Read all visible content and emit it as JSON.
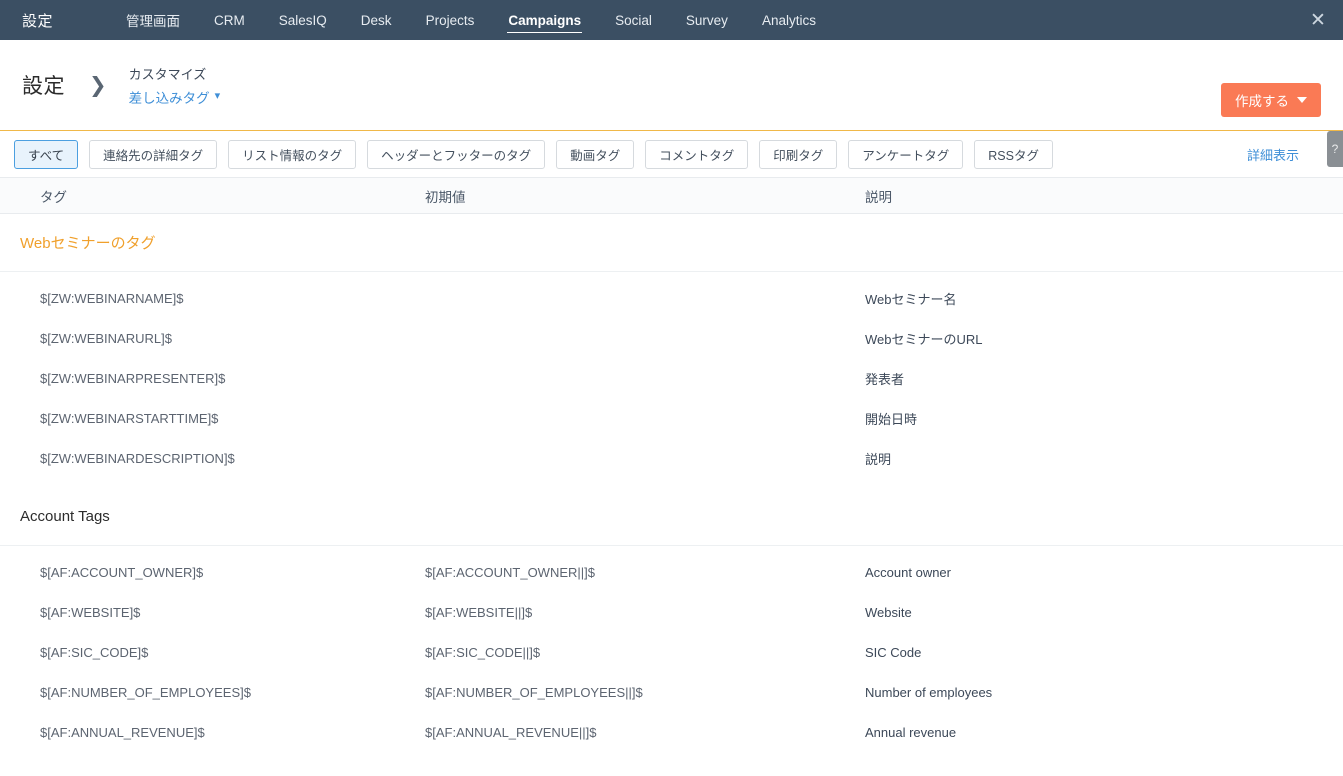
{
  "topnav": {
    "brand": "設定",
    "items": [
      {
        "label": "管理画面",
        "active": false
      },
      {
        "label": "CRM",
        "active": false
      },
      {
        "label": "SalesIQ",
        "active": false
      },
      {
        "label": "Desk",
        "active": false
      },
      {
        "label": "Projects",
        "active": false
      },
      {
        "label": "Campaigns",
        "active": true
      },
      {
        "label": "Social",
        "active": false
      },
      {
        "label": "Survey",
        "active": false
      },
      {
        "label": "Analytics",
        "active": false
      }
    ],
    "close_icon": "close-icon",
    "close_glyph": "✕"
  },
  "header": {
    "title": "設定",
    "separator_glyph": "❯",
    "breadcrumb_parent": "カスタマイズ",
    "breadcrumb_current": "差し込みタグ",
    "breadcrumb_caret_icon": "chevron-down-icon",
    "create_button": "作成する",
    "accent_color": "#f0b849",
    "create_button_color": "#fa7a55"
  },
  "filters": {
    "chips": [
      {
        "label": "すべて",
        "selected": true
      },
      {
        "label": "連絡先の詳細タグ",
        "selected": false
      },
      {
        "label": "リスト情報のタグ",
        "selected": false
      },
      {
        "label": "ヘッダーとフッターのタグ",
        "selected": false
      },
      {
        "label": "動画タグ",
        "selected": false
      },
      {
        "label": "コメントタグ",
        "selected": false
      },
      {
        "label": "印刷タグ",
        "selected": false
      },
      {
        "label": "アンケートタグ",
        "selected": false
      },
      {
        "label": "RSSタグ",
        "selected": false
      }
    ],
    "detail_link": "詳細表示",
    "help_tab": "?",
    "help_icon": "question-mark-icon"
  },
  "table": {
    "columns": [
      "タグ",
      "初期値",
      "説明"
    ],
    "sections": [
      {
        "title": "Webセミナーのタグ",
        "accent": true,
        "rows": [
          {
            "tag": "$[ZW:WEBINARNAME]$",
            "default": "",
            "description": "Webセミナー名"
          },
          {
            "tag": "$[ZW:WEBINARURL]$",
            "default": "",
            "description": "WebセミナーのURL"
          },
          {
            "tag": "$[ZW:WEBINARPRESENTER]$",
            "default": "",
            "description": "発表者"
          },
          {
            "tag": "$[ZW:WEBINARSTARTTIME]$",
            "default": "",
            "description": "開始日時"
          },
          {
            "tag": "$[ZW:WEBINARDESCRIPTION]$",
            "default": "",
            "description": "説明"
          }
        ]
      },
      {
        "title": "Account Tags",
        "accent": false,
        "rows": [
          {
            "tag": "$[AF:ACCOUNT_OWNER]$",
            "default": "$[AF:ACCOUNT_OWNER||]$",
            "description": "Account owner"
          },
          {
            "tag": "$[AF:WEBSITE]$",
            "default": "$[AF:WEBSITE||]$",
            "description": "Website"
          },
          {
            "tag": "$[AF:SIC_CODE]$",
            "default": "$[AF:SIC_CODE||]$",
            "description": "SIC Code"
          },
          {
            "tag": "$[AF:NUMBER_OF_EMPLOYEES]$",
            "default": "$[AF:NUMBER_OF_EMPLOYEES||]$",
            "description": "Number of employees"
          },
          {
            "tag": "$[AF:ANNUAL_REVENUE]$",
            "default": "$[AF:ANNUAL_REVENUE||]$",
            "description": "Annual revenue"
          }
        ]
      }
    ]
  }
}
